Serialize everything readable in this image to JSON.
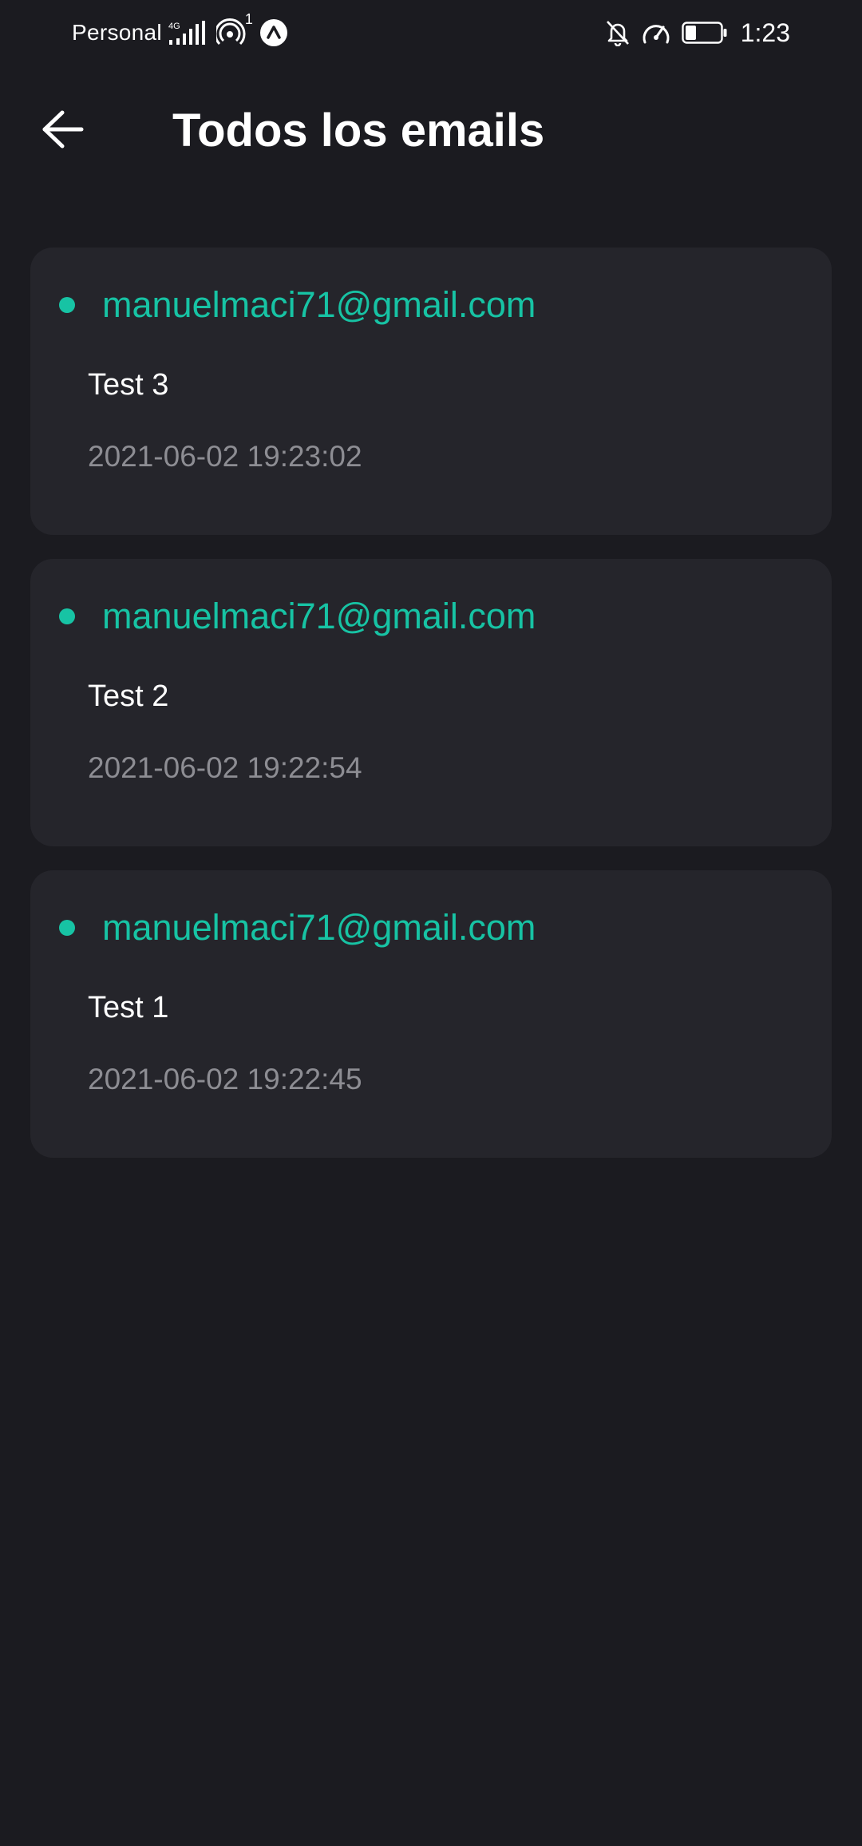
{
  "status_bar": {
    "carrier": "Personal",
    "network_type": "4G",
    "hotspot_badge": "1",
    "time": "1:23",
    "icons": [
      "signal-icon",
      "hotspot-icon",
      "app-notification-icon",
      "bell-off-icon",
      "speedometer-icon",
      "battery-icon"
    ]
  },
  "header": {
    "title": "Todos los emails",
    "back_icon": "arrow-left-icon"
  },
  "colors": {
    "background": "#1b1b20",
    "card": "#25252b",
    "accent": "#17c3a4",
    "muted_text": "#8d8d93"
  },
  "emails": [
    {
      "sender": "manuelmaci71@gmail.com",
      "subject": "Test 3",
      "date": "2021-06-02 19:23:02",
      "unread": true
    },
    {
      "sender": "manuelmaci71@gmail.com",
      "subject": "Test 2",
      "date": "2021-06-02 19:22:54",
      "unread": true
    },
    {
      "sender": "manuelmaci71@gmail.com",
      "subject": "Test 1",
      "date": "2021-06-02 19:22:45",
      "unread": true
    }
  ]
}
